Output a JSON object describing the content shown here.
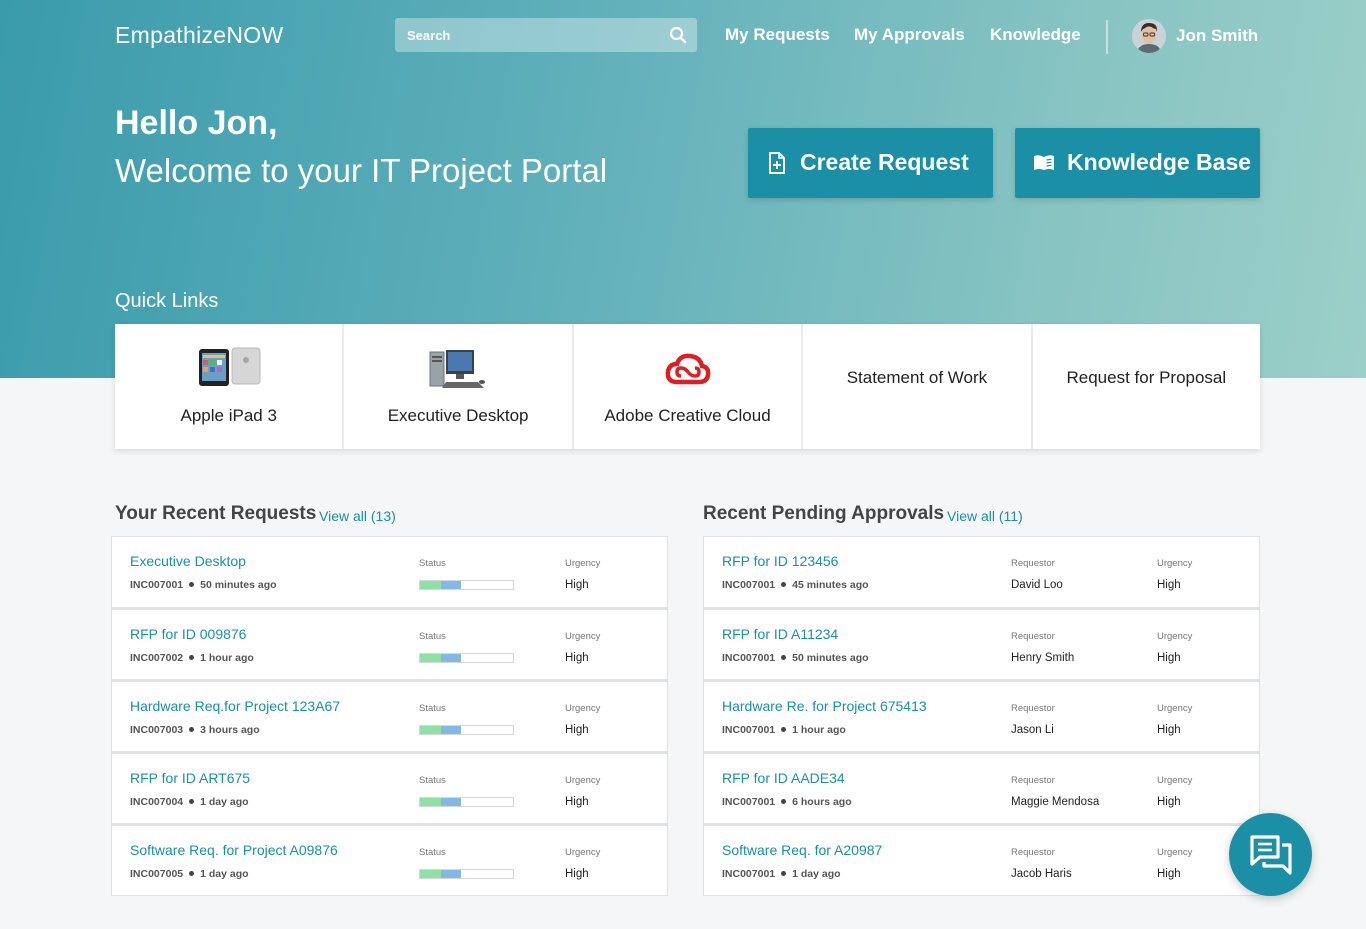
{
  "header": {
    "brand": "EmpathizeNOW",
    "search_placeholder": "Search",
    "nav": [
      "My Requests",
      "My Approvals",
      "Knowledge"
    ],
    "user_name": "Jon Smith"
  },
  "hero": {
    "greeting": "Hello Jon,",
    "welcome": "Welcome to your IT Project Portal",
    "create_request_label": "Create Request",
    "knowledge_base_label": "Knowledge Base"
  },
  "quick_links": {
    "title": "Quick Links",
    "items": [
      {
        "label": "Apple iPad 3",
        "icon": "ipad-icon"
      },
      {
        "label": "Executive Desktop",
        "icon": "desktop-computer-icon"
      },
      {
        "label": "Adobe Creative Cloud",
        "icon": "creative-cloud-icon"
      },
      {
        "label": "Statement of Work",
        "icon": ""
      },
      {
        "label": "Request for Proposal",
        "icon": ""
      }
    ]
  },
  "recent_requests": {
    "title": "Your Recent Requests",
    "view_all": "View all (13)",
    "status_label": "Status",
    "urgency_label": "Urgency",
    "items": [
      {
        "title": "Executive Desktop",
        "id": "INC007001",
        "time": "50 minutes ago",
        "urgency": "High"
      },
      {
        "title": "RFP for ID 009876",
        "id": "INC007002",
        "time": "1 hour ago",
        "urgency": "High"
      },
      {
        "title": "Hardware Req.for Project  123A67",
        "id": "INC007003",
        "time": "3 hours ago",
        "urgency": "High"
      },
      {
        "title": "RFP for ID ART675",
        "id": "INC007004",
        "time": "1 day ago",
        "urgency": "High"
      },
      {
        "title": "Software Req. for Project  A09876",
        "id": "INC007005",
        "time": "1 day ago",
        "urgency": "High"
      }
    ]
  },
  "pending_approvals": {
    "title": "Recent Pending Approvals",
    "view_all": "View all (11)",
    "requestor_label": "Requestor",
    "urgency_label": "Urgency",
    "items": [
      {
        "title": "RFP for ID 123456",
        "id": "INC007001",
        "time": "45 minutes ago",
        "requestor": "David Loo",
        "urgency": "High"
      },
      {
        "title": "RFP for ID A11234",
        "id": "INC007001",
        "time": "50 minutes ago",
        "requestor": "Henry Smith",
        "urgency": "High"
      },
      {
        "title": "Hardware Re. for Project 675413",
        "id": "INC007001",
        "time": "1 hour ago",
        "requestor": "Jason Li",
        "urgency": "High"
      },
      {
        "title": "RFP for ID AADE34",
        "id": "INC007001",
        "time": "6 hours ago",
        "requestor": "Maggie Mendosa",
        "urgency": "High"
      },
      {
        "title": "Software Req. for A20987",
        "id": "INC007001",
        "time": "1 day ago",
        "requestor": "Jacob Haris",
        "urgency": "High"
      }
    ]
  },
  "colors": {
    "accent": "#1a8fa6",
    "status_done": "#8ee0a4",
    "status_progress": "#86b8e6"
  }
}
